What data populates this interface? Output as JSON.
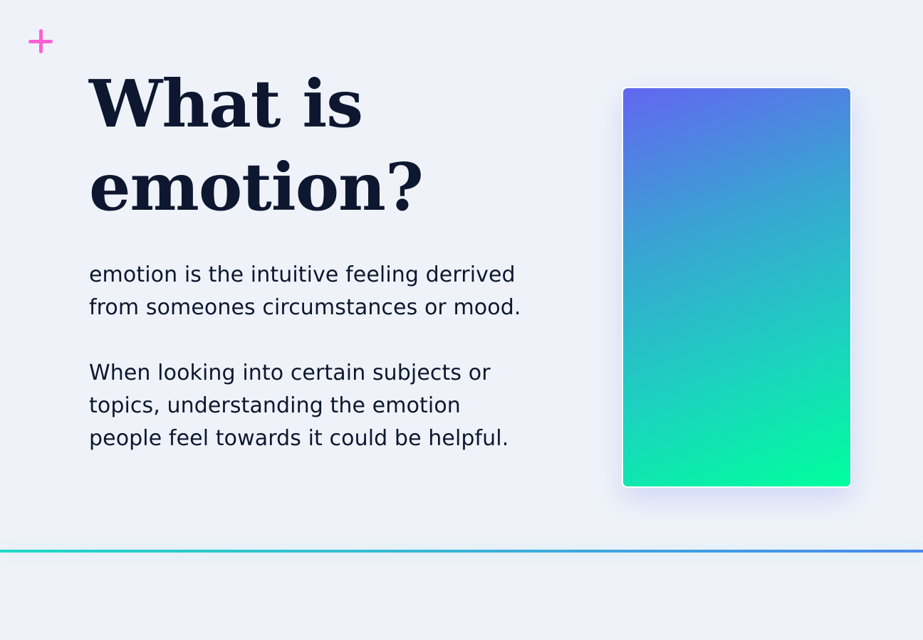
{
  "title_lines": [
    "What is",
    "emotion?"
  ],
  "paragraphs": [
    {
      "lines": [
        "emotion is the intuitive feeling derrived",
        "from someones circumstances or mood."
      ]
    },
    {
      "lines": [
        "When looking into certain subjects or",
        "topics, understanding the emotion",
        "people feel towards it could be helpful."
      ]
    }
  ],
  "icons": {
    "top_left": "plus-icon"
  },
  "colors": {
    "background": "#eff3f9",
    "text": "#0d1730",
    "accent_pink": "#ff5fd6",
    "gradient_start": "#6366f1",
    "gradient_end": "#00ff9d",
    "line_left": "#1ed8c7",
    "line_right": "#4a88ee"
  }
}
